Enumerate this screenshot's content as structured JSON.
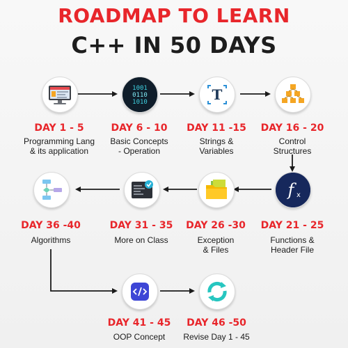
{
  "title": {
    "line1": "ROADMAP TO LEARN",
    "line2": "C++ IN 50 DAYS"
  },
  "colors": {
    "accent": "#e8262b",
    "text": "#1a1a1a",
    "arrow": "#1a1a1a"
  },
  "steps": [
    {
      "day": "DAY 1 - 5",
      "desc": [
        "Programming Lang",
        "& its application"
      ],
      "icon": "computer-screen-icon"
    },
    {
      "day": "DAY 6 - 10",
      "desc": [
        "Basic Concepts",
        "- Operation"
      ],
      "icon": "binary-code-icon"
    },
    {
      "day": "DAY 11 -15",
      "desc": [
        "Strings &",
        "Variables"
      ],
      "icon": "text-t-icon"
    },
    {
      "day": "DAY 16 - 20",
      "desc": [
        "Control",
        "Structures"
      ],
      "icon": "hierarchy-icon"
    },
    {
      "day": "DAY 21 - 25",
      "desc": [
        "Functions &",
        "Header File"
      ],
      "icon": "function-fx-icon"
    },
    {
      "day": "DAY 26 -30",
      "desc": [
        "Exception",
        "& Files"
      ],
      "icon": "folder-files-icon"
    },
    {
      "day": "DAY 31 - 35",
      "desc": [
        "More on Class"
      ],
      "icon": "class-code-icon"
    },
    {
      "day": "DAY 36 -40",
      "desc": [
        "Algorithms"
      ],
      "icon": "flowchart-icon"
    },
    {
      "day": "DAY 41 - 45",
      "desc": [
        "OOP Concept"
      ],
      "icon": "code-brackets-icon"
    },
    {
      "day": "DAY 46 -50",
      "desc": [
        "Revise Day 1 - 45"
      ],
      "icon": "refresh-cycle-icon"
    }
  ]
}
